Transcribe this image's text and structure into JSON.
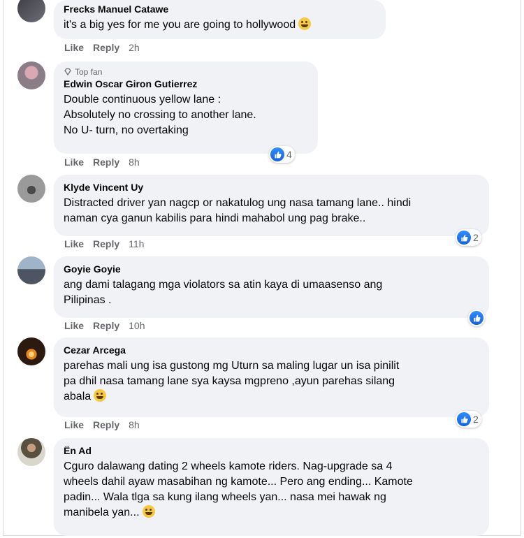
{
  "actions": {
    "like": "Like",
    "reply": "Reply"
  },
  "badges": {
    "top_fan": "Top fan"
  },
  "comments": [
    {
      "author": "Frecks Manuel Catawe",
      "lines": [
        "it's a big yes for me you are going to hollywood"
      ],
      "emoji": "laughing-emoji-icon",
      "time": "2h",
      "reactions": null
    },
    {
      "author": "Edwin Oscar Giron Gutierrez",
      "top_fan": true,
      "lines": [
        "Double continuous yellow lane :",
        "Absolutely no crossing to another lane.",
        "No U- turn, no overtaking"
      ],
      "time": "8h",
      "reactions": "4"
    },
    {
      "author": "Klyde Vincent Uy",
      "lines": [
        "Distracted driver yan nagcp or nakatulog ung nasa tamang lane.. hindi",
        "naman cya ganun kabilis para hindi mahabol ung pag brake.."
      ],
      "time": "11h",
      "reactions": "2"
    },
    {
      "author": "Goyie Goyie",
      "lines": [
        "ang dami talagang mga violators sa atin kaya di umaasenso ang",
        "Pilipinas ."
      ],
      "time": "10h",
      "reactions": ""
    },
    {
      "author": "Cezar Arcega",
      "lines": [
        "parehas mali ung isa gustong mg Uturn sa maling lugar un isa pinilit",
        "pa dhil nasa tamang lane sya kaysa mgpreno ,ayun parehas silang",
        "abala"
      ],
      "emoji": "laughing-emoji-icon",
      "time": "8h",
      "reactions": "2"
    },
    {
      "author": "Ën Ad",
      "lines": [
        "Cguro dalawang dating 2 wheels kamote riders. Nag-upgrade sa 4",
        "wheels dahil ayaw masabihan ng kamote... Pero ang ending... Kamote",
        "padin... Wala tlga sa kung ilang wheels yan... nasa mei hawak ng",
        "manibela yan..."
      ],
      "emoji": "laughing-emoji-icon"
    }
  ],
  "colors": {
    "bubble": "#f0f2f5",
    "meta": "#65676b",
    "like_blue": "#1877f2"
  }
}
